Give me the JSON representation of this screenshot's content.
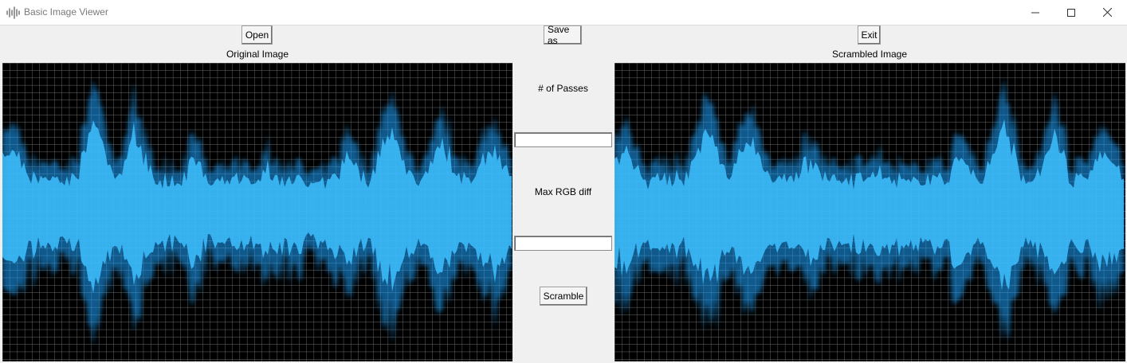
{
  "window": {
    "title": "Basic Image Viewer",
    "icon": "waveform-icon",
    "controls": [
      "minimize-icon",
      "maximize-icon",
      "close-icon"
    ]
  },
  "toolbar": {
    "open_label": "Open",
    "save_as_label": "Save as",
    "exit_label": "Exit"
  },
  "panels": {
    "original_title": "Original Image",
    "scrambled_title": "Scrambled Image"
  },
  "controls": {
    "passes_label": "# of Passes",
    "passes_value": "",
    "max_rgb_label": "Max RGB diff",
    "max_rgb_value": "",
    "scramble_label": "Scramble"
  },
  "colors": {
    "wave": "#1aa3ff",
    "wave_core": "#3ec0ff",
    "grid": "#6e6e6e",
    "image_bg": "#000000",
    "window_bg": "#f0f0f0"
  }
}
